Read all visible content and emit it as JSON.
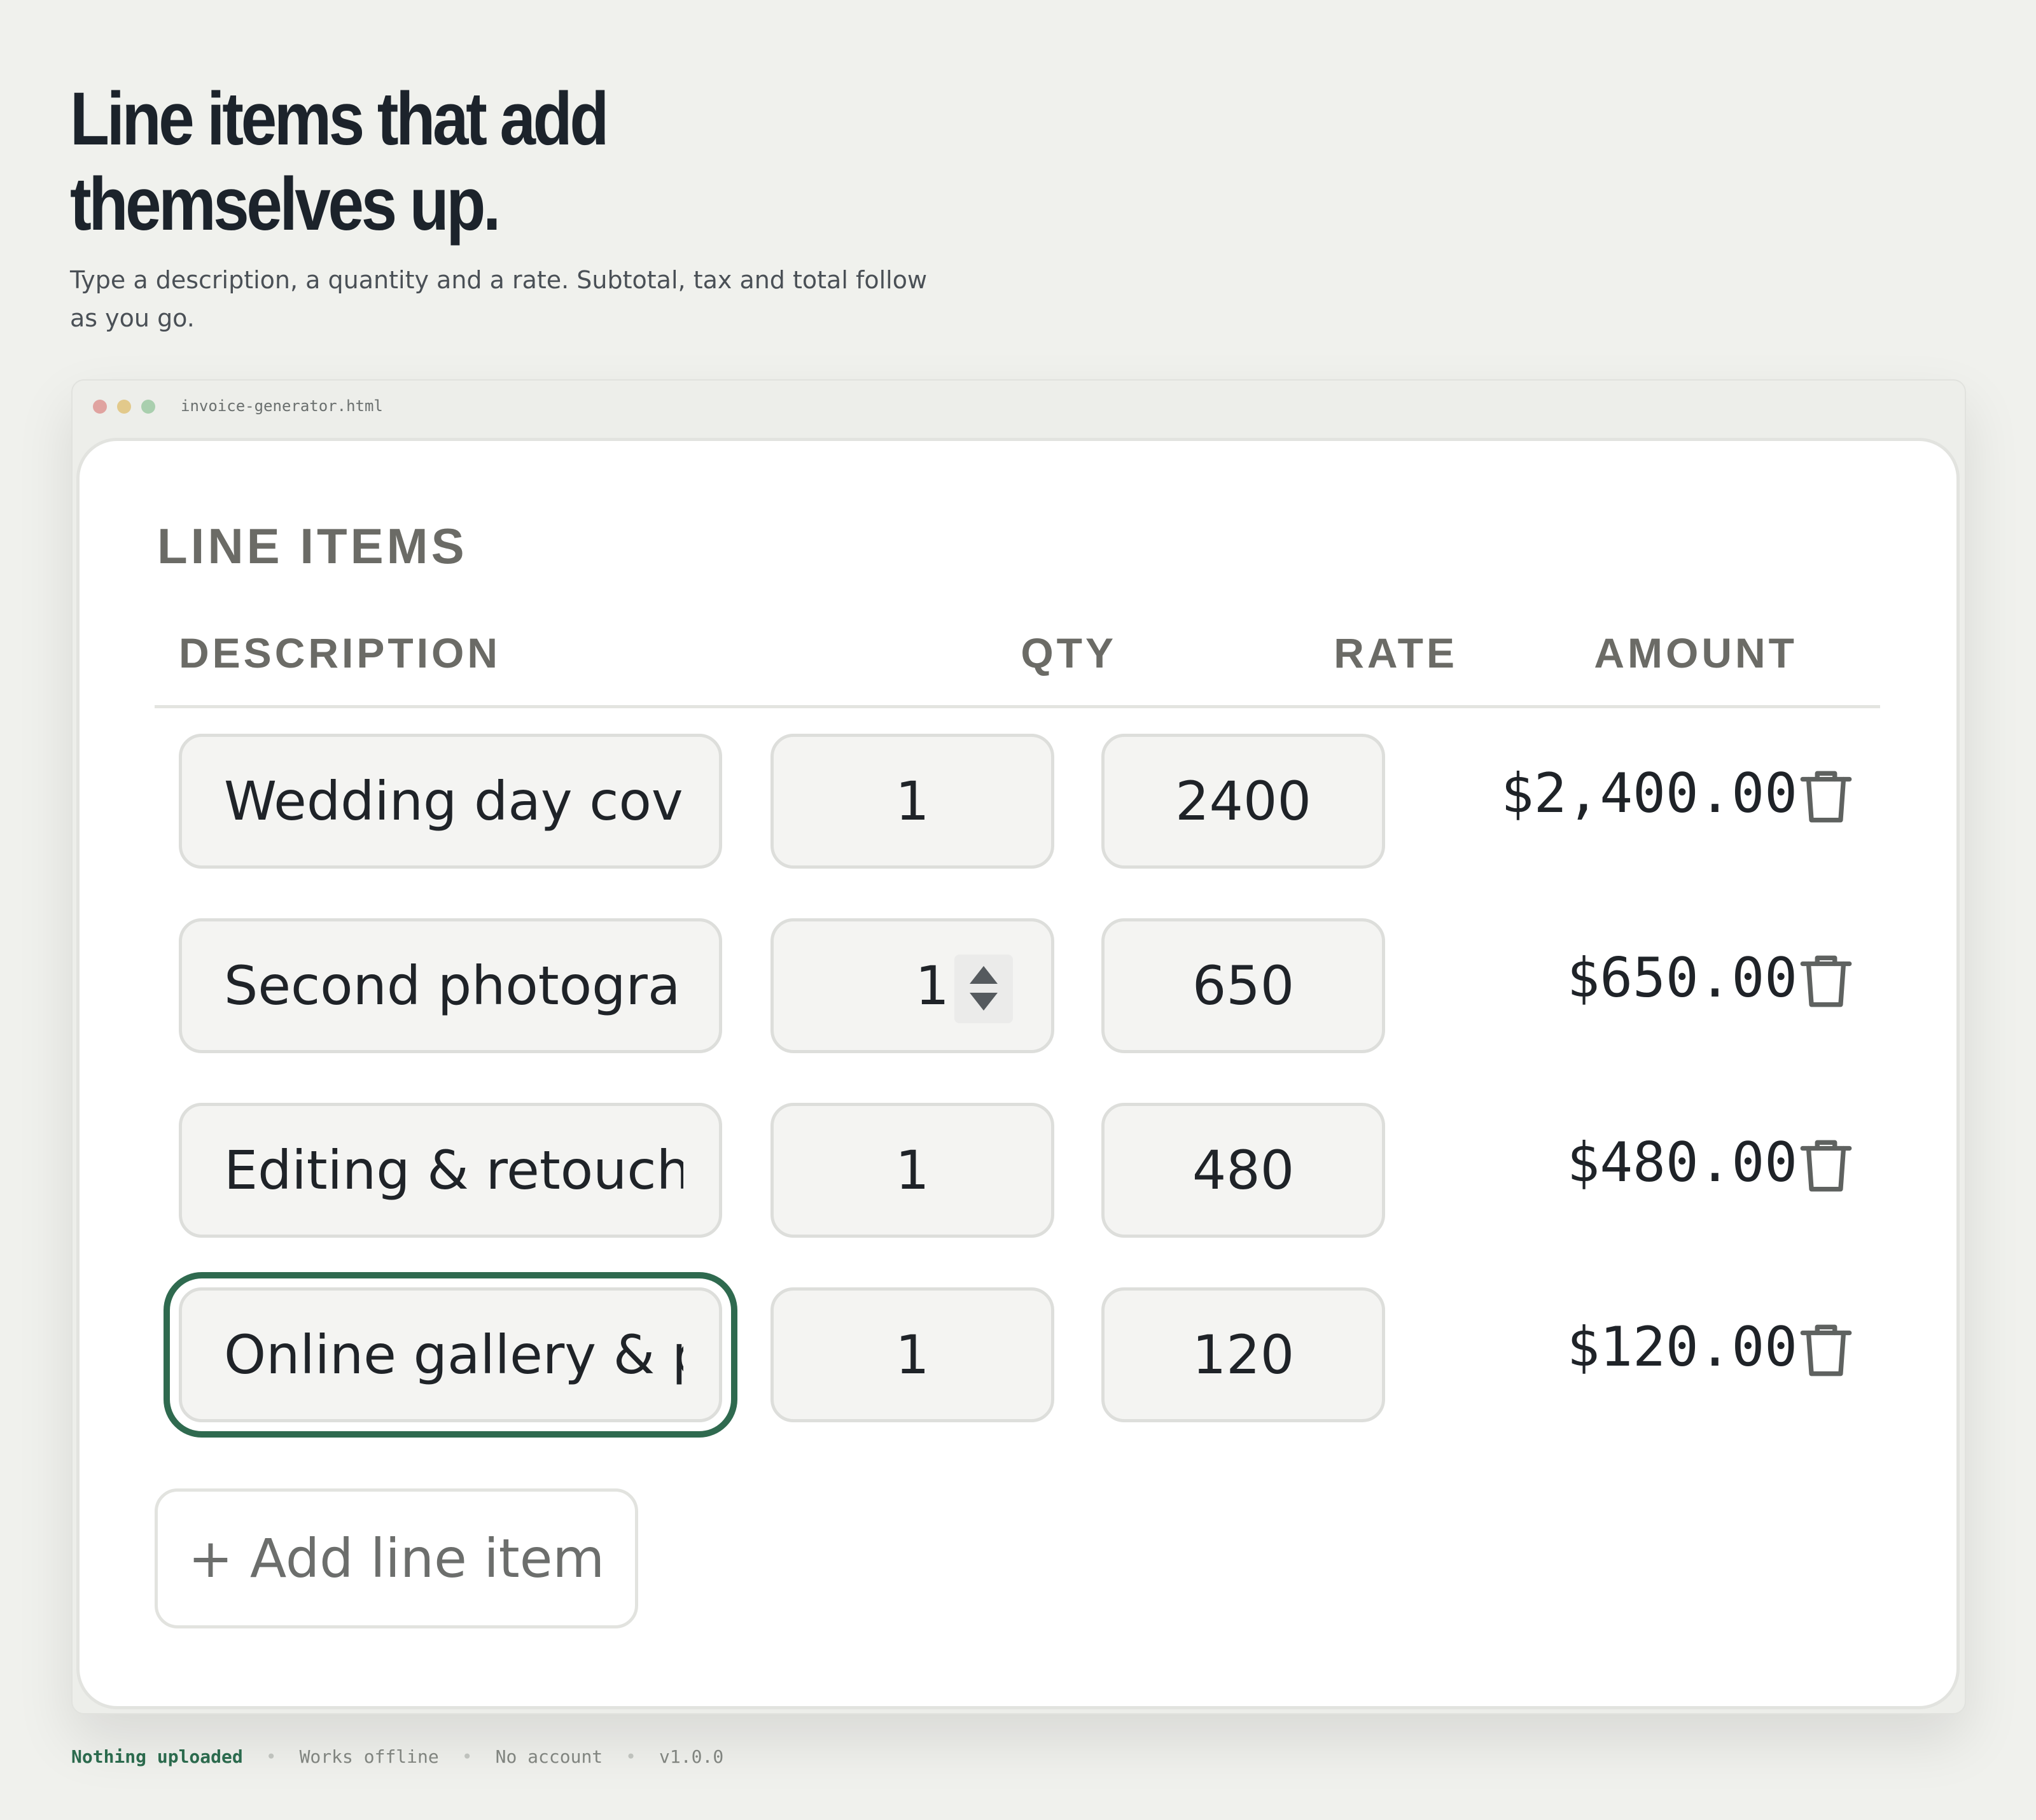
{
  "hero": {
    "title_line1": "Line items that add",
    "title_line2": "themselves up.",
    "subtitle": "Type a description, a quantity and a rate. Subtotal, tax and total follow as you go."
  },
  "window": {
    "filename": "invoice-generator.html"
  },
  "line_items": {
    "section_title": "LINE ITEMS",
    "headers": {
      "description": "DESCRIPTION",
      "qty": "QTY",
      "rate": "RATE",
      "amount": "AMOUNT"
    },
    "rows": [
      {
        "description": "Wedding day coverage",
        "qty": "1",
        "rate": "2400",
        "amount": "$2,400.00"
      },
      {
        "description": "Second photographer",
        "qty": "1",
        "rate": "650",
        "amount": "$650.00"
      },
      {
        "description": "Editing & retouching",
        "qty": "1",
        "rate": "480",
        "amount": "$480.00"
      },
      {
        "description": "Online gallery & print",
        "qty": "1",
        "rate": "120",
        "amount": "$120.00"
      }
    ],
    "add_label": "+ Add line item",
    "icons": {
      "delete": "trash-icon"
    }
  },
  "footer": {
    "items": [
      "Nothing uploaded",
      "Works offline",
      "No account",
      "v1.0.0"
    ]
  },
  "colors": {
    "background": "#f0f1ed",
    "accent": "#2f6a4f",
    "heading": "#1c232b"
  }
}
